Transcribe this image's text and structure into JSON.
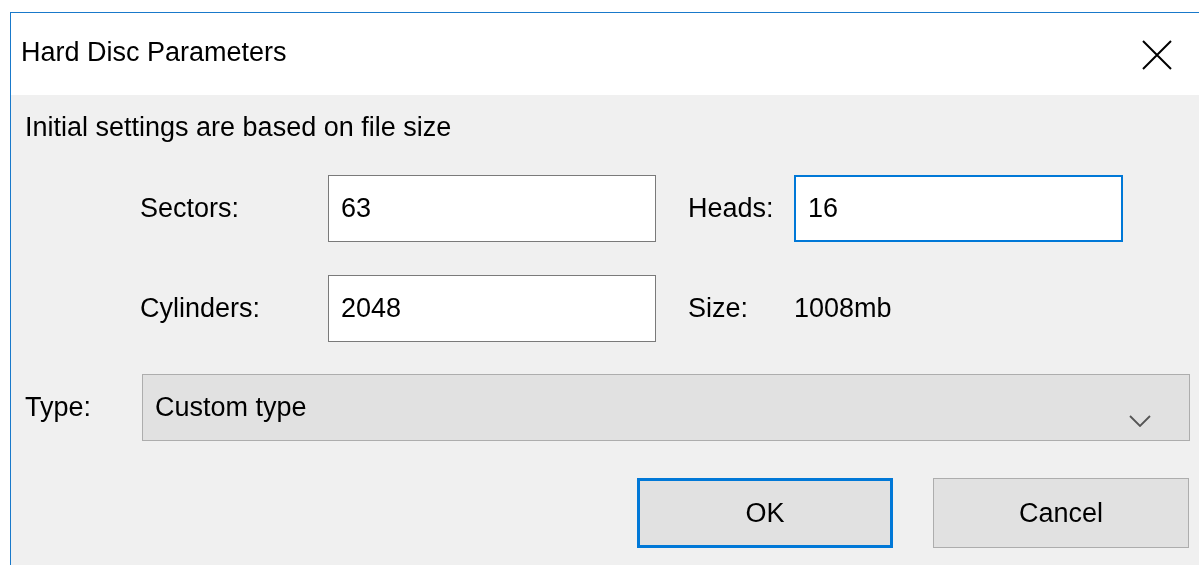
{
  "window": {
    "title": "Hard Disc Parameters"
  },
  "intro": "Initial settings are based on file size",
  "fields": [
    {
      "label": "Sectors:",
      "value": "63",
      "focused": false
    },
    {
      "label": "Heads:",
      "value": "16",
      "focused": true
    },
    {
      "label": "Cylinders:",
      "value": "2048",
      "focused": false
    }
  ],
  "size": {
    "label": "Size:",
    "value": "1008mb"
  },
  "type": {
    "label": "Type:",
    "value": "Custom type"
  },
  "buttons": [
    {
      "label": "OK",
      "focused": true
    },
    {
      "label": "Cancel",
      "focused": false
    }
  ]
}
